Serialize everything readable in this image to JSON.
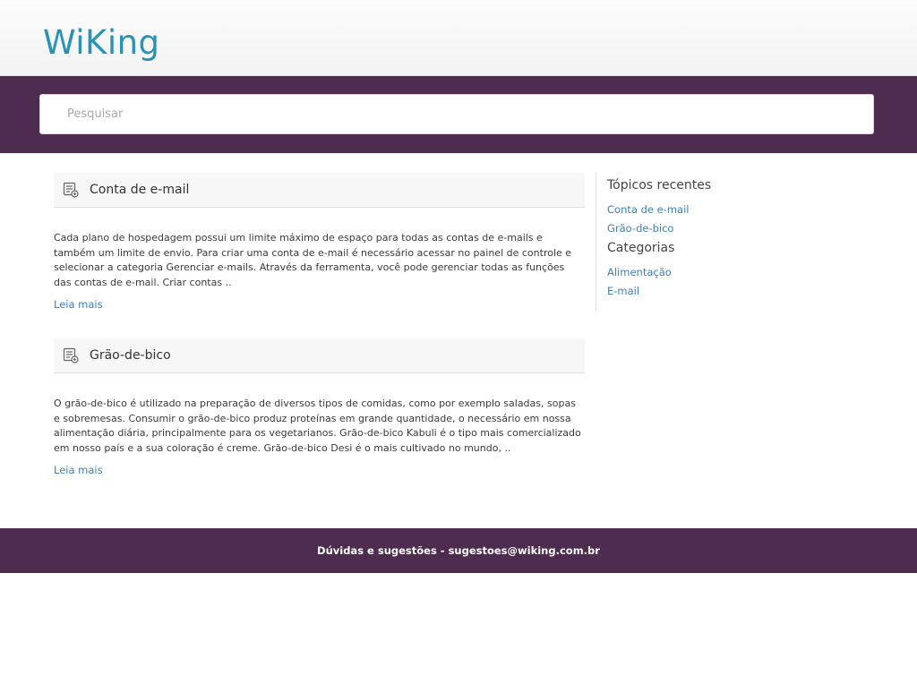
{
  "site": {
    "logo": "WiKing"
  },
  "search": {
    "placeholder": "Pesquisar"
  },
  "posts": [
    {
      "icon": "article-list-icon",
      "title": "Conta de e-mail",
      "excerpt": "Cada plano de hospedagem possui um limite máximo de espaço para todas as contas de e-mails e também um limite de envio. Para criar uma conta de e-mail é necessário acessar no painel de controle e selecionar a categoria Gerenciar e-mails. Através da ferramenta, você pode gerenciar todas as funções das contas de e-mail.   Criar contas ..",
      "read_more": "Leia mais"
    },
    {
      "icon": "article-list-icon",
      "title": "Grão-de-bico",
      "excerpt": "O grão-de-bico é utilizado na preparação de diversos tipos de comidas, como por exemplo saladas, sopas e sobremesas. Consumir o grão-de-bico produz proteínas em grande quantidade, o necessário em nossa alimentação diária, principalmente para os vegetarianos.   Grão-de-bico Kabuli é o tipo mais comercializado em nosso país e a sua coloração é creme. Grão-de-bico Desi é o mais cultivado no mundo, ..",
      "read_more": "Leia mais"
    }
  ],
  "sidebar": {
    "recent_title": "Tópicos recentes",
    "recent": [
      "Conta de e-mail",
      "Grão-de-bico"
    ],
    "categories_title": "Categorias",
    "categories": [
      "Alimentação",
      "E-mail"
    ]
  },
  "footer": {
    "text": "Dúvidas e sugestões - sugestoes@wiking.com.br"
  },
  "colors": {
    "brand": "#2a93b3",
    "band": "#4d2c4f",
    "link": "#3c7fba"
  }
}
